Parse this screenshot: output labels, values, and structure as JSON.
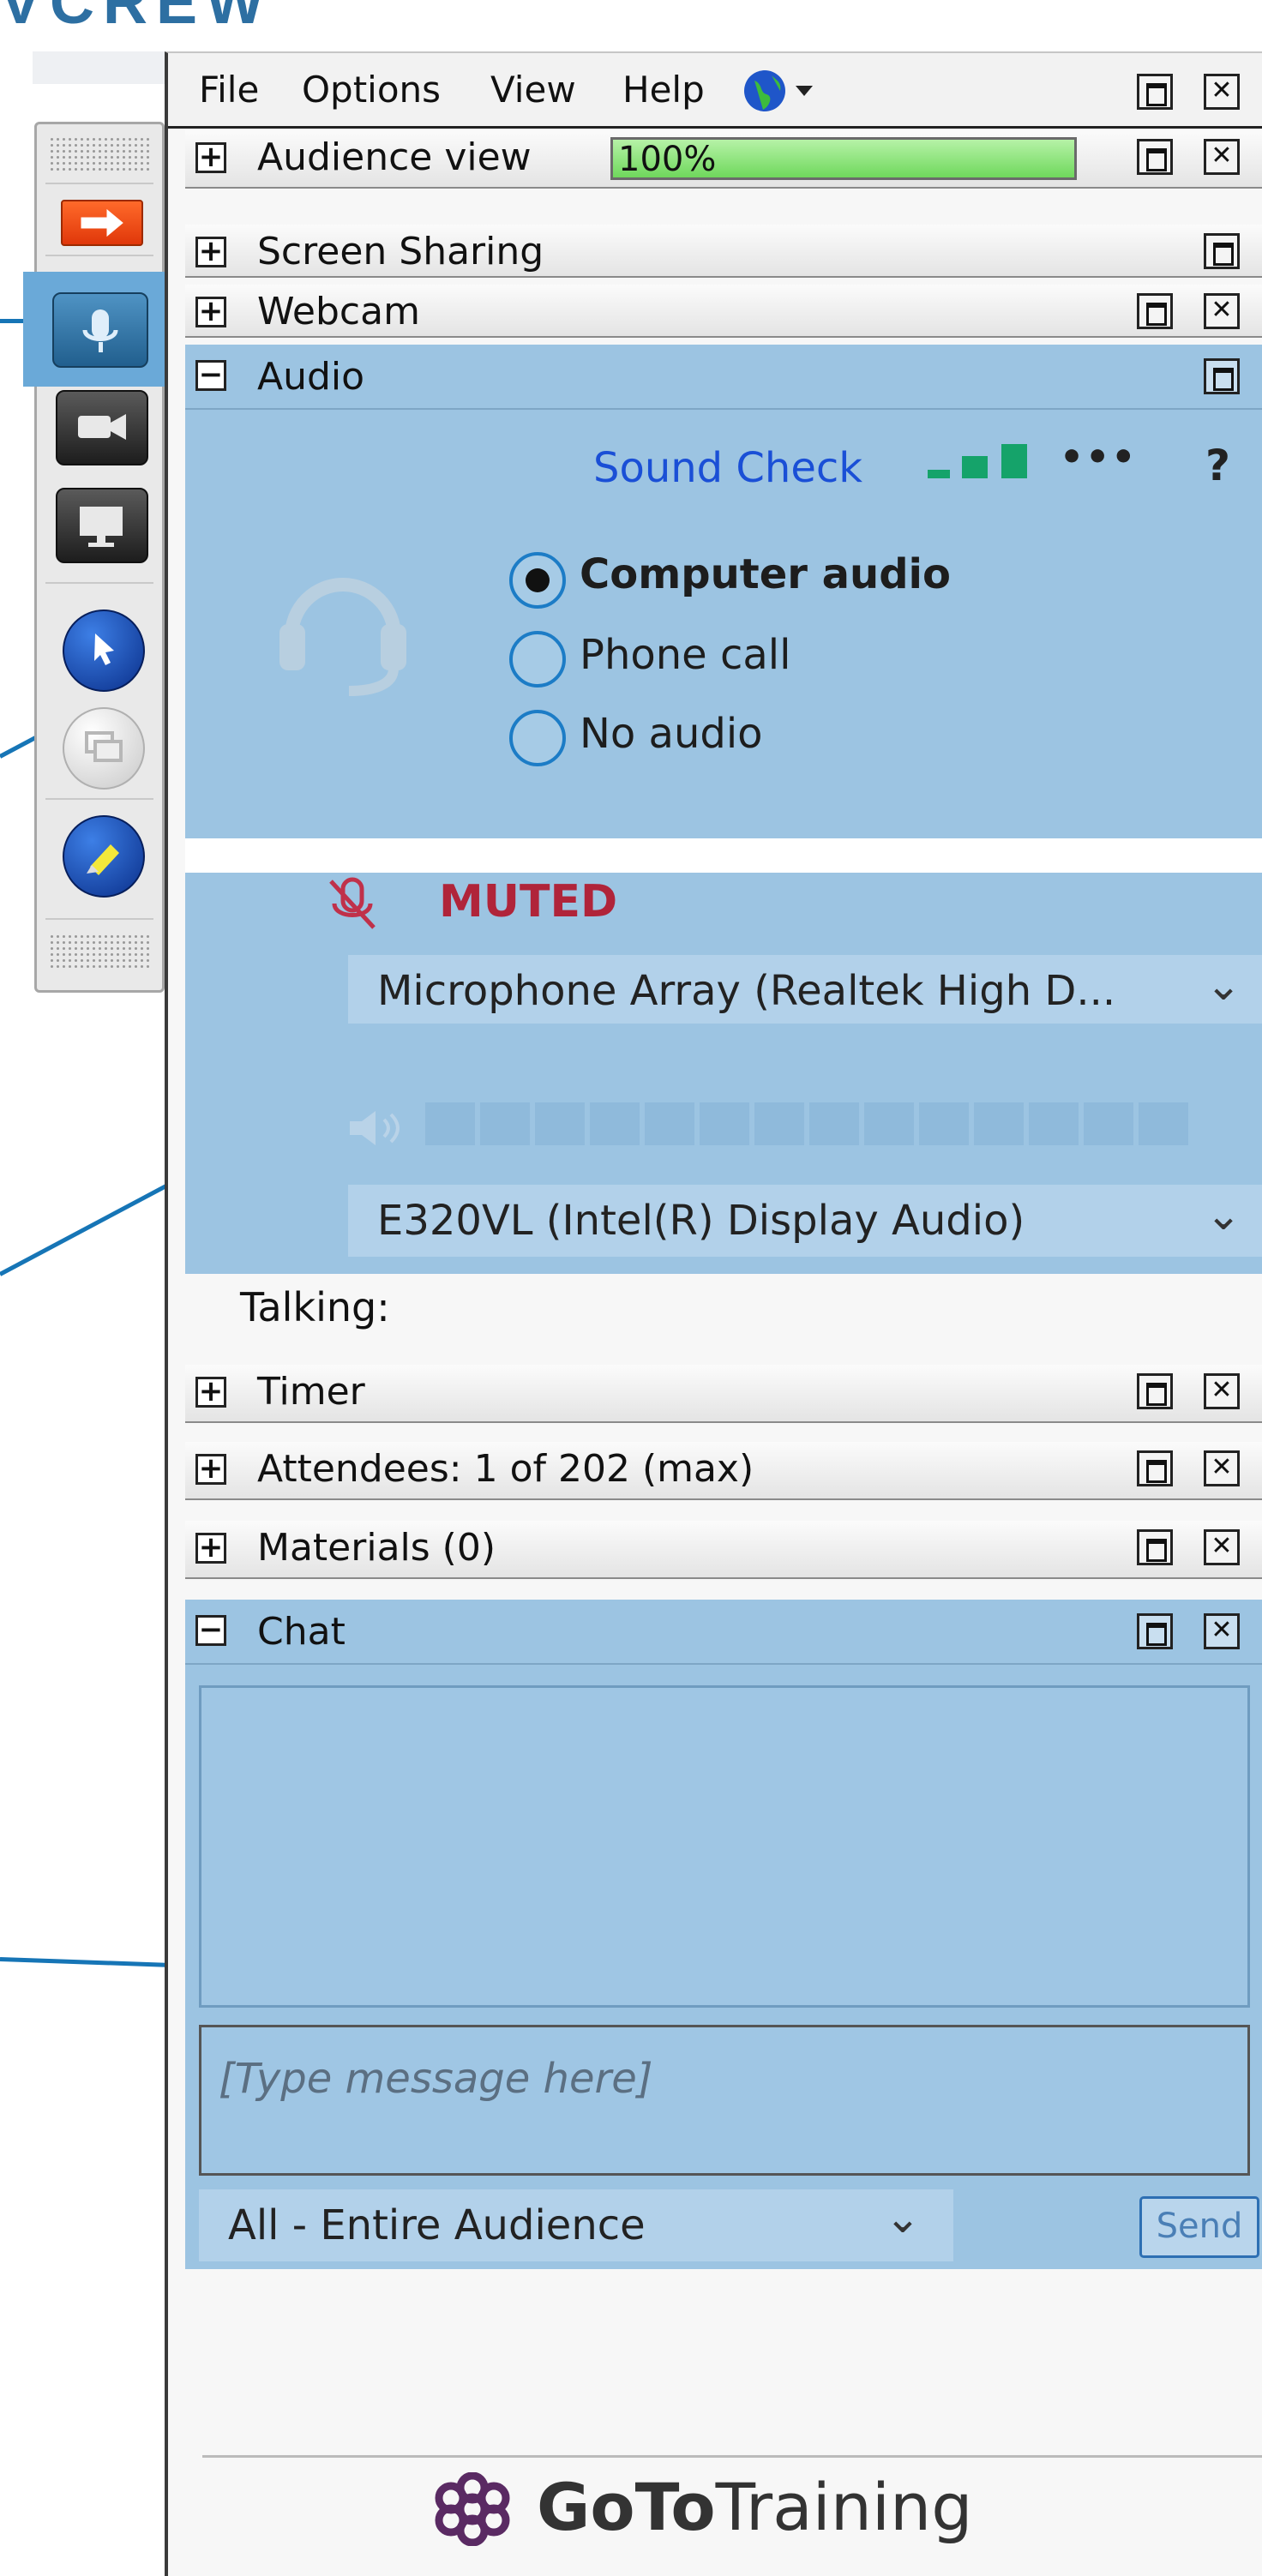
{
  "slide": {
    "heading_clipped": "VCREW"
  },
  "menubar": {
    "items": [
      "File",
      "Options",
      "View",
      "Help"
    ],
    "globe_icon": "globe-icon"
  },
  "sections": {
    "audience_view": {
      "label": "Audience view",
      "progress_text": "100%",
      "progress": 1.0
    },
    "screen_sharing": {
      "label": "Screen Sharing"
    },
    "webcam": {
      "label": "Webcam"
    },
    "audio": {
      "label": "Audio"
    },
    "timer": {
      "label": "Timer"
    },
    "attendees": {
      "label": "Attendees:  1 of 202 (max)"
    },
    "materials": {
      "label": "Materials (0)"
    },
    "chat": {
      "label": "Chat"
    }
  },
  "audio": {
    "sound_check": "Sound Check",
    "more": "•••",
    "help": "?",
    "options": [
      {
        "label": "Computer audio",
        "selected": true
      },
      {
        "label": "Phone call",
        "selected": false
      },
      {
        "label": "No audio",
        "selected": false
      }
    ],
    "muted_label": "MUTED",
    "microphone": "Microphone Array (Realtek High D...",
    "speaker": "E320VL (Intel(R) Display Audio)",
    "talking_label": "Talking:",
    "level": 0
  },
  "chat": {
    "placeholder": "[Type message here]",
    "recipient": "All - Entire Audience",
    "send_label": "Send"
  },
  "brand": {
    "logo_bold": "GoTo",
    "logo_light": "Training"
  },
  "colors": {
    "accent_blue": "#9cc4e2",
    "callout_blue": "#1675b6",
    "muted_red": "#b0243a",
    "link_blue": "#1a4fd6",
    "signal_green": "#15a36a",
    "progress_green": "#8ee27d"
  }
}
